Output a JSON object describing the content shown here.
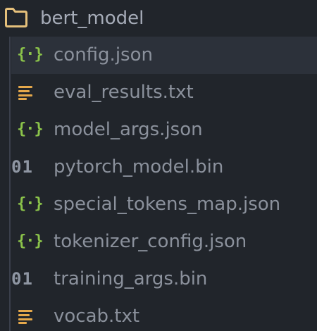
{
  "folder": {
    "name": "bert_model",
    "icon": "folder-icon",
    "icon_color": "#e5c07b"
  },
  "files": [
    {
      "name": "config.json",
      "icon": "json-icon",
      "selected": true
    },
    {
      "name": "eval_results.txt",
      "icon": "text-file-icon"
    },
    {
      "name": "model_args.json",
      "icon": "json-icon"
    },
    {
      "name": "pytorch_model.bin",
      "icon": "binary-file-icon",
      "icon_text": "01"
    },
    {
      "name": "special_tokens_map.json",
      "icon": "json-icon"
    },
    {
      "name": "tokenizer_config.json",
      "icon": "json-icon"
    },
    {
      "name": "training_args.bin",
      "icon": "binary-file-icon",
      "icon_text": "01"
    },
    {
      "name": "vocab.txt",
      "icon": "text-file-icon"
    }
  ],
  "colors": {
    "background": "#21252b",
    "selected_row": "#2c313a",
    "json_icon": "#8bc34a",
    "text_icon": "#e5a84b",
    "binary_icon": "#8f96a3",
    "label": "#8b919c"
  }
}
